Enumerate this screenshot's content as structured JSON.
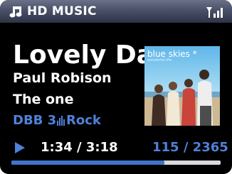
{
  "header": {
    "title": "HD MUSIC",
    "music_icon": "music-note-icon",
    "signal_icon": "signal-strength-icon"
  },
  "track": {
    "title": "Lovely Da",
    "artist": "Paul Robison",
    "album": "The one"
  },
  "audio": {
    "station": "DBB 3",
    "genre_icon": "equalizer-icon",
    "genre": "Rock"
  },
  "playback": {
    "state_icon": "play-icon",
    "time": "1:34 / 3:18",
    "count": "115 / 2365",
    "progress": 0.73
  },
  "album_art": {
    "title": "blue skies *",
    "subtitle": "wonderful life"
  },
  "colors": {
    "accent": "#4f81d9",
    "header_top": "#6a7188",
    "header_bottom": "#2f3346",
    "progress_fill": "#3f73cc",
    "progress_track": "#d7d9de"
  }
}
